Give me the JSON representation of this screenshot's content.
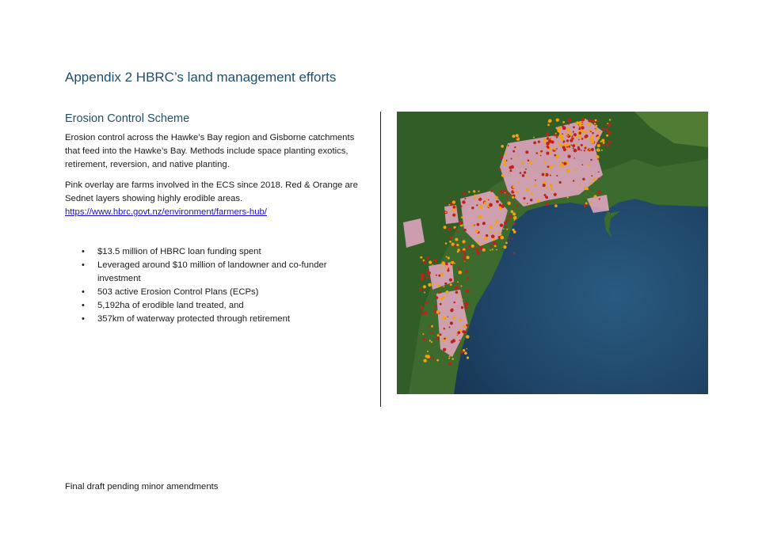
{
  "title": "Appendix 2 HBRC’s land management efforts",
  "section": {
    "heading": "Erosion Control Scheme",
    "paragraph1": "Erosion control across the Hawke’s Bay region and Gisborne catchments that feed into the Hawke’s Bay. Methods include space planting exotics, retirement, reversion, and native planting.",
    "paragraph2": "Pink overlay are farms involved in the ECS since 2018. Red & Orange are Sednet layers showing highly erodible areas.",
    "link": "https://www.hbrc.govt.nz/environment/farmers-hub/"
  },
  "bullets": [
    "$13.5 million of HBRC loan funding spent",
    "Leveraged around $10 million of landowner and co-funder investment",
    "503 active Erosion Control Plans (ECPs)",
    "5,192ha of erodible land treated, and",
    "357km of waterway protected through retirement"
  ],
  "bullet_symbol": "•",
  "footer": "Final draft pending minor amendments",
  "colors": {
    "heading": "#1f4e6b",
    "link": "#1a0dcc",
    "sea": "#1d3a5a",
    "land": "#3f6e2e",
    "farm_overlay": "#e7a9c6",
    "sednet_red": "#c0221b",
    "sednet_orange": "#f2a20f"
  },
  "map": {
    "image": "satellite-map-hawkes-bay"
  }
}
